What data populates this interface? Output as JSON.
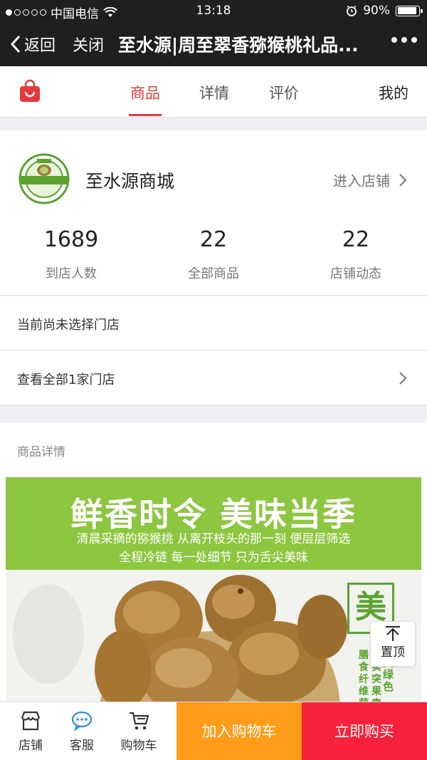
{
  "status_bar": {
    "carrier": "中国电信",
    "time": "13:18",
    "battery": "90%",
    "signal_icon": "signal-dots-icon",
    "wifi_icon": "wifi-icon",
    "alarm_icon": "alarm-icon"
  },
  "nav": {
    "back_label": "返回",
    "close_label": "关闭",
    "title": "至水源|周至翠香猕猴桃礼品...",
    "more_icon": "more-icon"
  },
  "tabs": {
    "items": [
      {
        "label": "商品"
      },
      {
        "label": "详情"
      },
      {
        "label": "评价"
      },
      {
        "label": "我的"
      }
    ],
    "active": "商品",
    "accent": "#e4393c"
  },
  "shop": {
    "name": "至水源商城",
    "enter_label": "进入店铺",
    "stats": [
      {
        "value": "1689",
        "label": "到店人数"
      },
      {
        "value": "22",
        "label": "全部商品"
      },
      {
        "value": "22",
        "label": "店铺动态"
      }
    ]
  },
  "store_rows": {
    "current": "当前尚未选择门店",
    "view_all": "查看全部1家门店"
  },
  "detail": {
    "section_label": "商品详情",
    "banner_heading": "鲜香时令 美味当季",
    "banner_line1": "清晨采摘的猕猴桃 从离开枝头的那一刻 便层层筛选",
    "banner_line2": "全程冷链 每一处细节 只为舌尖美味",
    "mei_char": "美",
    "banner_color": "#8dc63f"
  },
  "back_to_top": {
    "label": "置顶"
  },
  "bottom_bar": {
    "shop_label": "店铺",
    "service_label": "客服",
    "cart_label": "购物车",
    "add_to_cart": "加入购物车",
    "buy_now": "立即购买",
    "add_color": "#ff9c1a",
    "buy_color": "#f8213b"
  }
}
